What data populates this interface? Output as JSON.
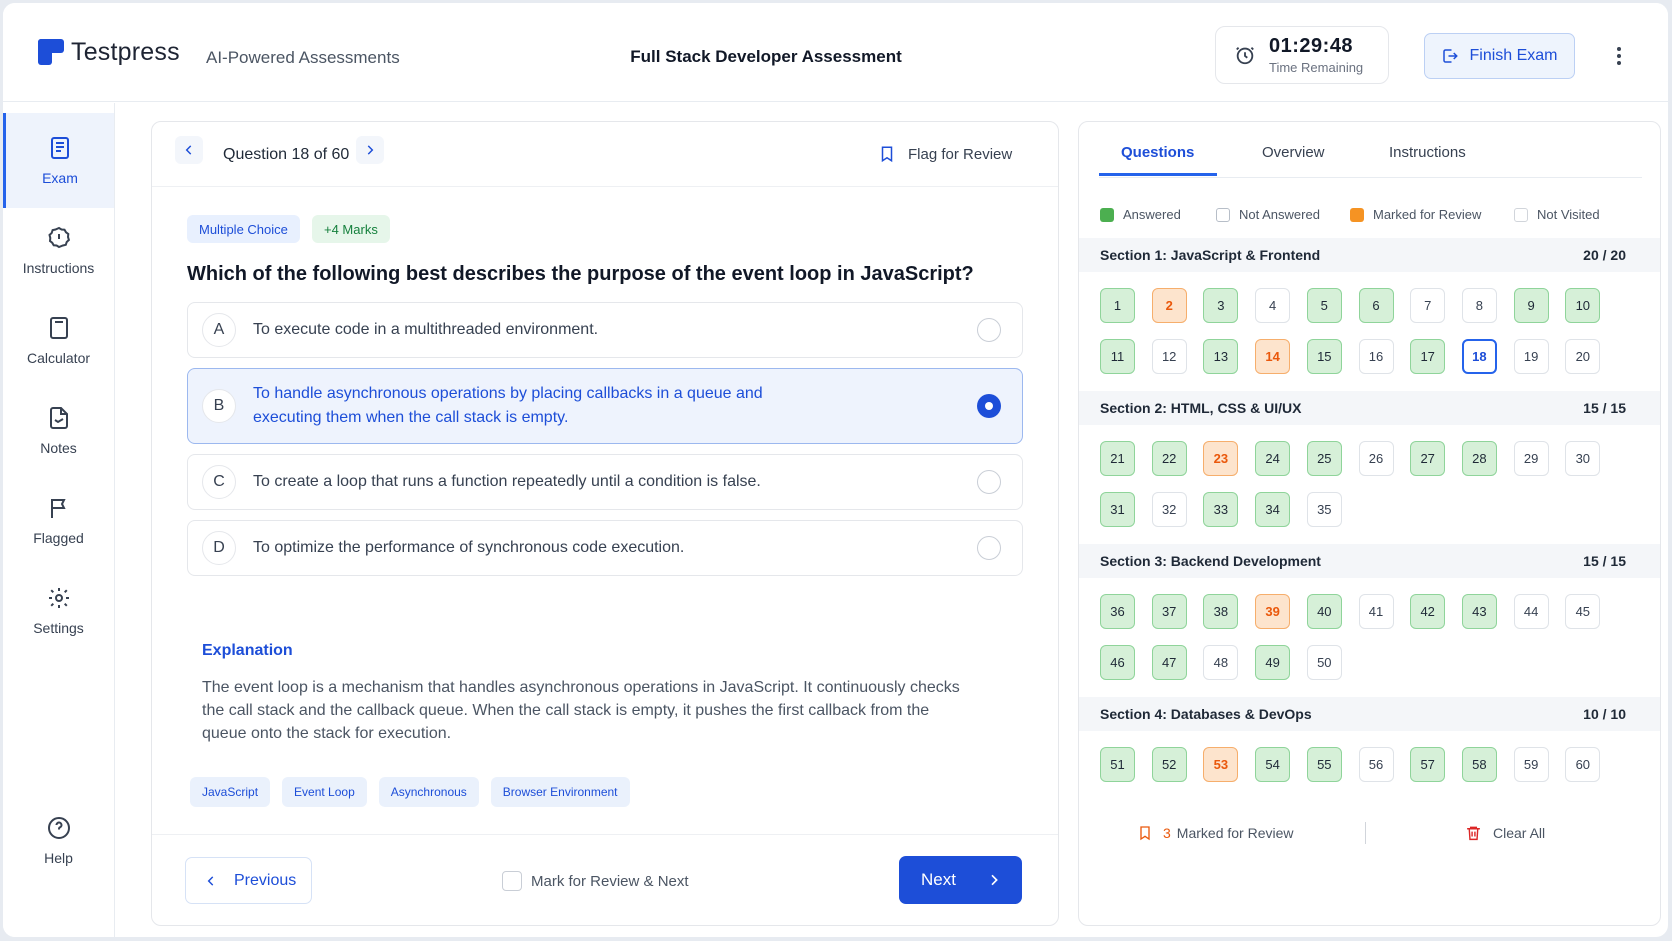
{
  "header": {
    "brand": "Testpress",
    "tagline": "AI-Powered Assessments",
    "exam_title": "Full Stack Developer Assessment",
    "timer_value": "01:29:48",
    "timer_label": "Time Remaining",
    "finish_label": "Finish Exam"
  },
  "sidebar": {
    "items": [
      {
        "label": "Exam",
        "icon": "document-icon",
        "active": true
      },
      {
        "label": "Instructions",
        "icon": "info-icon"
      },
      {
        "label": "Calculator",
        "icon": "calculator-icon"
      },
      {
        "label": "Notes",
        "icon": "notes-icon"
      },
      {
        "label": "Flagged",
        "icon": "flag-icon"
      },
      {
        "label": "Settings",
        "icon": "gear-icon"
      },
      {
        "label": "Help",
        "icon": "help-icon"
      }
    ]
  },
  "question": {
    "counter": "Question 18 of 60",
    "flag_label": "Flag for Review",
    "type_tag": "Multiple Choice",
    "marks_tag": "+4 Marks",
    "text": "Which of the following best describes the purpose of the event loop in JavaScript?",
    "options": [
      {
        "letter": "A",
        "text": "To execute code in a multithreaded environment."
      },
      {
        "letter": "B",
        "text": "To handle asynchronous operations by placing callbacks in a queue and executing them when the call stack is empty.",
        "selected": true
      },
      {
        "letter": "C",
        "text": "To create a loop that runs a function repeatedly until a condition is false."
      },
      {
        "letter": "D",
        "text": "To optimize the performance of synchronous code execution."
      }
    ],
    "explanation_title": "Explanation",
    "explanation": "The event loop is a mechanism that handles asynchronous operations in JavaScript. It continuously checks the call stack and the callback queue. When the call stack is empty, it pushes the first callback from the queue onto the stack for execution.",
    "topics": [
      "JavaScript",
      "Event Loop",
      "Asynchronous",
      "Browser Environment"
    ]
  },
  "footer": {
    "previous_label": "Previous",
    "mark_next_label": "Mark for Review & Next",
    "next_label": "Next"
  },
  "panel": {
    "tabs": [
      "Questions",
      "Overview",
      "Instructions"
    ],
    "active_tab": "Questions",
    "legend": [
      {
        "label": "Answered",
        "color": "#4caf50"
      },
      {
        "label": "Not Answered",
        "color": "#ffffff"
      },
      {
        "label": "Marked for Review",
        "color": "#f59323"
      },
      {
        "label": "Not Visited",
        "color": "#ffffff"
      }
    ],
    "sections": [
      {
        "title": "Section 1: JavaScript & Frontend",
        "count": "20 / 20",
        "answered": [
          1,
          3,
          5,
          6,
          9,
          10,
          11,
          13,
          15,
          17
        ],
        "review": [
          2,
          14
        ],
        "current": 18,
        "from": 1,
        "to": 20
      },
      {
        "title": "Section 2: HTML, CSS & UI/UX",
        "count": "15 / 15",
        "answered": [
          21,
          22,
          24,
          25,
          27,
          28,
          31,
          33,
          34
        ],
        "review": [
          23
        ],
        "from": 21,
        "to": 35
      },
      {
        "title": "Section 3: Backend Development",
        "count": "15 / 15",
        "answered": [
          36,
          37,
          38,
          40,
          42,
          43,
          46,
          47,
          49
        ],
        "review": [
          39
        ],
        "from": 36,
        "to": 50
      },
      {
        "title": "Section 4: Databases & DevOps",
        "count": "10 / 10",
        "answered": [
          51,
          52,
          54,
          55,
          57,
          58
        ],
        "review": [
          53
        ],
        "from": 51,
        "to": 60
      }
    ],
    "marked_count": "3",
    "marked_label": "Marked for Review",
    "clear_label": "Clear All"
  }
}
